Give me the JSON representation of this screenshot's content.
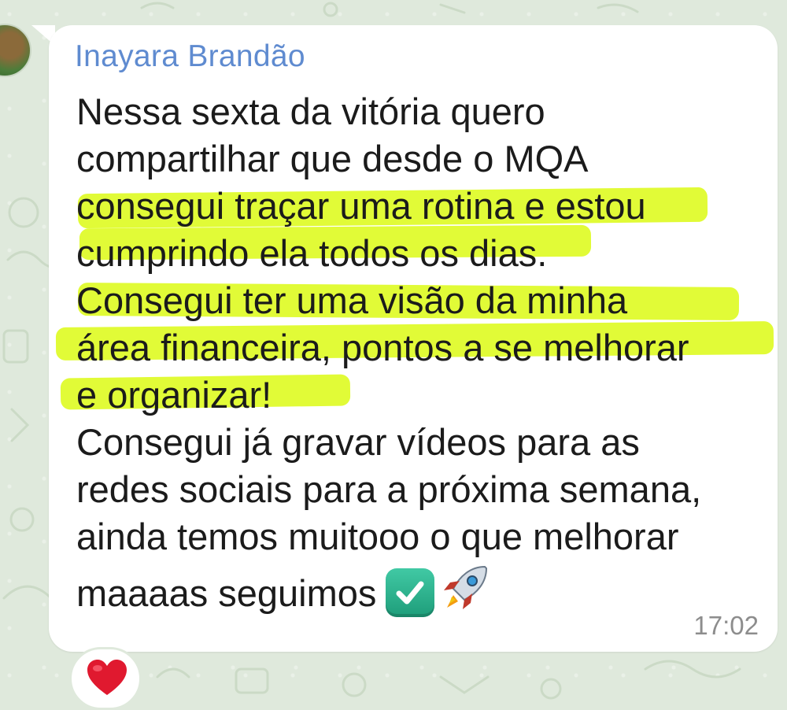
{
  "chat": {
    "sender_name": "Inayara Brandão",
    "message_lines": [
      "Nessa sexta da vitória quero",
      "compartilhar que desde o MQA",
      "consegui traçar uma rotina e estou",
      "cumprindo ela todos os dias.",
      "Consegui ter uma visão da minha",
      "área financeira, pontos a se melhorar",
      "e organizar!",
      "Consegui já gravar vídeos para as",
      "redes sociais para a próxima semana,",
      "ainda temos muitooo o que melhorar",
      "maaaas seguimos"
    ],
    "emojis": [
      "check-mark-button-emoji",
      "rocket-emoji"
    ],
    "timestamp": "17:02",
    "reaction": "heart-emoji"
  },
  "colors": {
    "sender_name": "#5f8bd0",
    "highlight": "#dcfa14",
    "wallpaper": "#dfe9dc",
    "bubble": "#ffffff"
  }
}
